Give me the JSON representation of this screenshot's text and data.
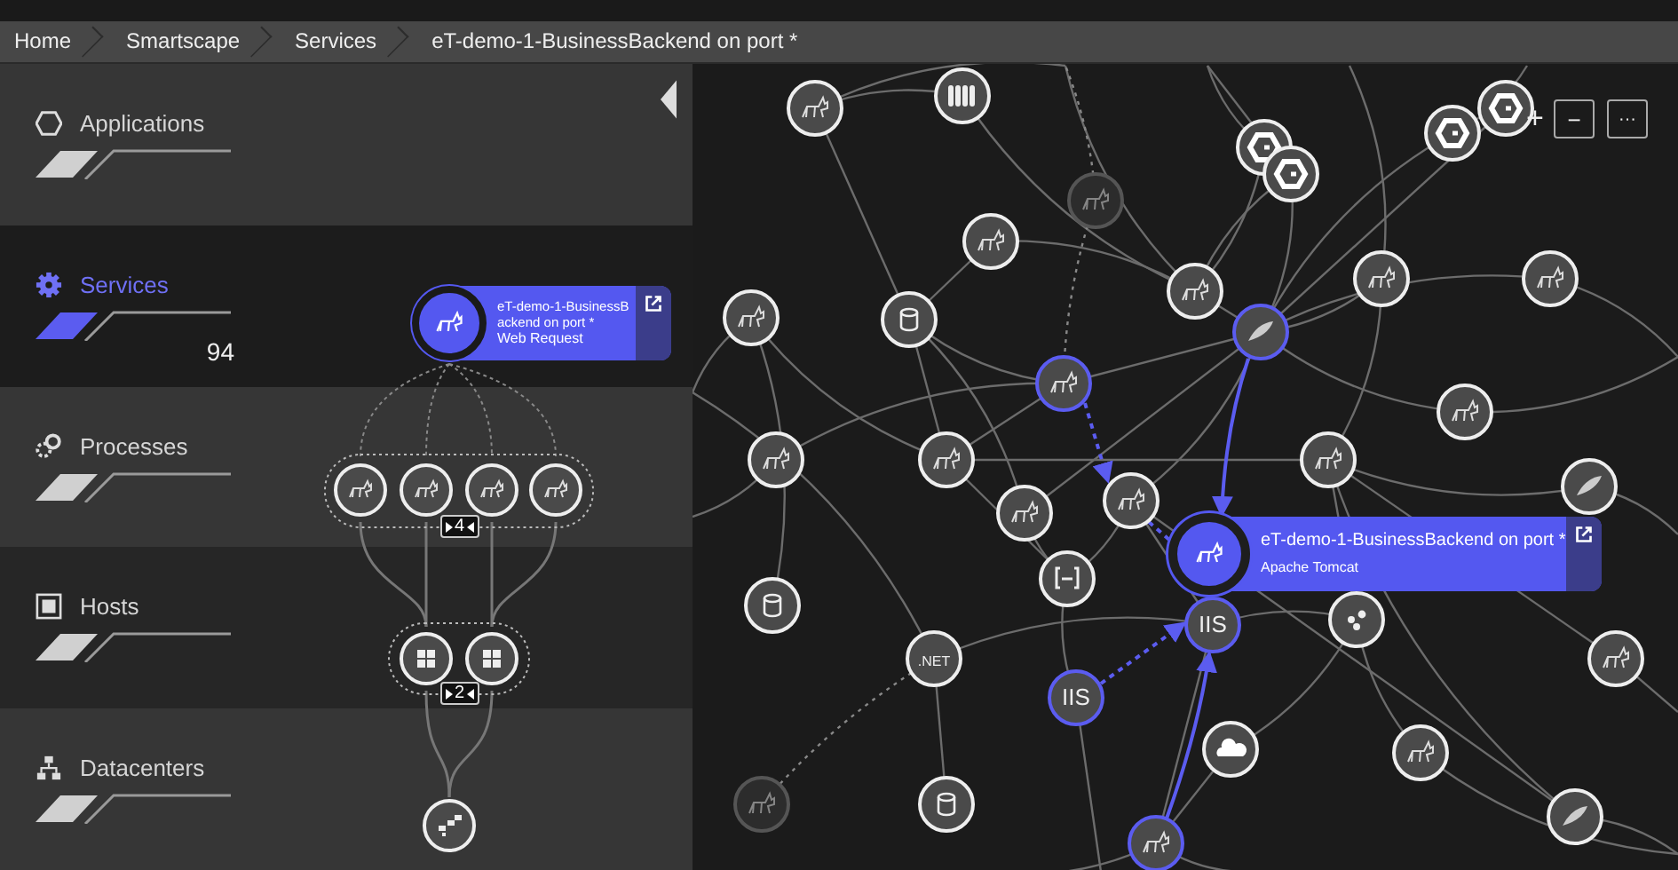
{
  "breadcrumbs": [
    {
      "label": "Home"
    },
    {
      "label": "Smartscape"
    },
    {
      "label": "Services"
    },
    {
      "label": "eT-demo-1-BusinessBackend on port *"
    }
  ],
  "layers": [
    {
      "kind": "applications",
      "name": "Applications",
      "selected": false
    },
    {
      "kind": "services",
      "name": "Services",
      "selected": true,
      "count": "94"
    },
    {
      "kind": "processes",
      "name": "Processes",
      "selected": false
    },
    {
      "kind": "hosts",
      "name": "Hosts",
      "selected": false
    },
    {
      "kind": "datacenters",
      "name": "Datacenters",
      "selected": false
    }
  ],
  "selected_service": {
    "title": "eT-demo-1-BusinessBackend on port *",
    "subtitle": "Web Request"
  },
  "process_group": {
    "count": "4"
  },
  "host_group": {
    "count": "2"
  },
  "zoom_controls": [
    {
      "kind": "plus",
      "label": "+"
    },
    {
      "kind": "minus",
      "label": "−"
    },
    {
      "kind": "more",
      "label": "···"
    }
  ],
  "graph": {
    "focus_card": {
      "title": "eT-demo-1-BusinessBackend on port *",
      "subtitle": "Apache Tomcat"
    },
    "nodes": [
      {
        "kind": "cat",
        "highlighted": false,
        "faded": false
      },
      {
        "kind": "disks",
        "highlighted": false,
        "faded": false
      },
      {
        "kind": "cat",
        "highlighted": false,
        "faded": true
      },
      {
        "kind": "cat",
        "highlighted": false,
        "faded": false
      },
      {
        "kind": "cat",
        "highlighted": false,
        "faded": false
      },
      {
        "kind": "hexagon",
        "highlighted": false,
        "faded": false
      },
      {
        "kind": "hexagon",
        "highlighted": false,
        "faded": false
      },
      {
        "kind": "hexagon",
        "highlighted": false,
        "faded": false
      },
      {
        "kind": "hexagon",
        "highlighted": false,
        "faded": false
      },
      {
        "kind": "cat",
        "highlighted": false,
        "faded": false
      },
      {
        "kind": "cat",
        "highlighted": false,
        "faded": false
      },
      {
        "kind": "cat",
        "highlighted": false,
        "faded": false
      },
      {
        "kind": "database",
        "highlighted": false,
        "faded": false
      },
      {
        "kind": "feather",
        "highlighted": true,
        "faded": false
      },
      {
        "kind": "cat",
        "highlighted": true,
        "faded": false
      },
      {
        "kind": "cat",
        "highlighted": false,
        "faded": false
      },
      {
        "kind": "cat",
        "highlighted": false,
        "faded": false
      },
      {
        "kind": "cat",
        "highlighted": false,
        "faded": false
      },
      {
        "kind": "cat",
        "highlighted": false,
        "faded": false
      },
      {
        "kind": "cat",
        "highlighted": false,
        "faded": false
      },
      {
        "kind": "cat",
        "highlighted": false,
        "faded": false
      },
      {
        "kind": "feather",
        "highlighted": false,
        "faded": false
      },
      {
        "kind": "bracket",
        "highlighted": false,
        "faded": false
      },
      {
        "kind": "database",
        "highlighted": false,
        "faded": false
      },
      {
        "kind": "text",
        "label": ".NET",
        "highlighted": false,
        "faded": false
      },
      {
        "kind": "text",
        "label": "IIS",
        "highlighted": true,
        "faded": false
      },
      {
        "kind": "text",
        "label": "IIS",
        "highlighted": true,
        "faded": false
      },
      {
        "kind": "dots",
        "highlighted": false,
        "faded": false
      },
      {
        "kind": "cat",
        "highlighted": false,
        "faded": false
      },
      {
        "kind": "cloud",
        "highlighted": false,
        "faded": false
      },
      {
        "kind": "cat",
        "highlighted": false,
        "faded": false
      },
      {
        "kind": "cat",
        "highlighted": false,
        "faded": true
      },
      {
        "kind": "database",
        "highlighted": false,
        "faded": false
      },
      {
        "kind": "cat",
        "highlighted": true,
        "faded": false
      },
      {
        "kind": "feather",
        "highlighted": false,
        "faded": false
      }
    ]
  }
}
